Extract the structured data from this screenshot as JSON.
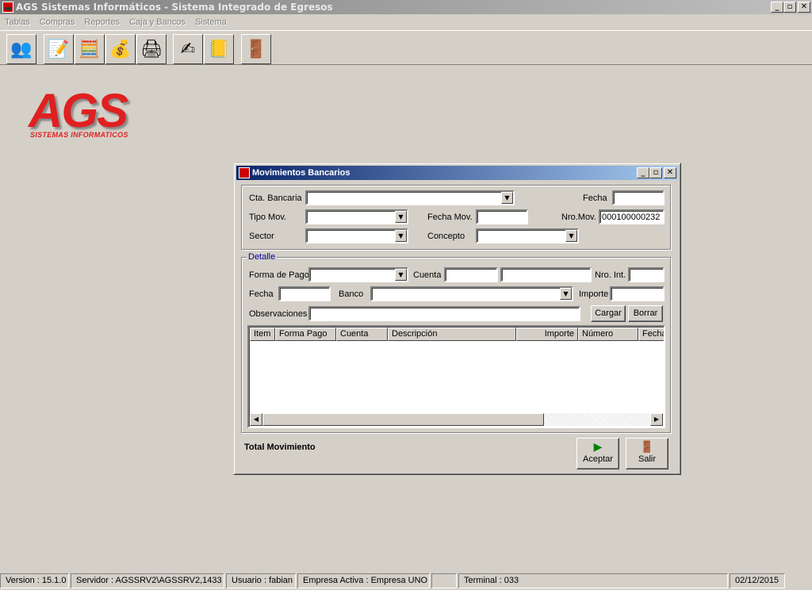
{
  "app": {
    "title": "AGS Sistemas Informáticos - Sistema Integrado de Egresos",
    "window_buttons": [
      "_",
      "▫",
      "✕"
    ]
  },
  "menu": [
    "Tablas",
    "Compras",
    "Reportes",
    "Caja y Bancos",
    "Sistema"
  ],
  "toolbar": {
    "buttons": [
      {
        "name": "users-icon",
        "glyph": "👥"
      },
      {
        "name": "document-edit-icon",
        "glyph": "📝"
      },
      {
        "name": "calculator-icon",
        "glyph": "🧮"
      },
      {
        "name": "money-bag-icon",
        "glyph": "💰"
      },
      {
        "name": "printer-icon",
        "glyph": "🖨"
      },
      {
        "name": "check-sign-icon",
        "glyph": "✍"
      },
      {
        "name": "ledger-book-icon",
        "glyph": "📒"
      },
      {
        "name": "exit-door-icon",
        "glyph": "🚪"
      }
    ]
  },
  "logo": {
    "main": "AGS",
    "sub": "SISTEMAS INFORMATICOS"
  },
  "dialog": {
    "title": "Movimientos Bancarios",
    "header": {
      "cta_bancaria_label": "Cta. Bancaria",
      "fecha_label": "Fecha",
      "fecha_value": "",
      "tipo_mov_label": "Tipo Mov.",
      "fecha_mov_label": "Fecha Mov.",
      "fecha_mov_value": "",
      "nro_mov_label": "Nro.Mov.",
      "nro_mov_value": "000100000232",
      "sector_label": "Sector",
      "concepto_label": "Concepto"
    },
    "detalle": {
      "group_label": "Detalle",
      "forma_pago_label": "Forma de Pago",
      "cuenta_label": "Cuenta",
      "nro_int_label": "Nro. Int.",
      "fecha_label": "Fecha",
      "banco_label": "Banco",
      "importe_label": "Importe",
      "observaciones_label": "Observaciones",
      "cargar_label": "Cargar",
      "borrar_label": "Borrar"
    },
    "grid": {
      "columns": [
        "Item",
        "Forma Pago",
        "Cuenta",
        "Descripción",
        "Importe",
        "Número",
        "Fecha"
      ]
    },
    "total_label": "Total Movimiento",
    "aceptar_label": "Aceptar",
    "salir_label": "Salir"
  },
  "status": {
    "version": "Version : 15.1.0",
    "servidor": "Servidor : AGSSRV2\\AGSSRV2,1433",
    "usuario": "Usuario : fabian",
    "empresa": "Empresa Activa : Empresa UNO",
    "blank": "",
    "terminal": "Terminal : 033",
    "date": "02/12/2015"
  },
  "colors": {
    "desktop": "#d4d0c8",
    "dialog_title": "#0a246a",
    "logo": "#e02020",
    "group_label": "#0000a0"
  }
}
